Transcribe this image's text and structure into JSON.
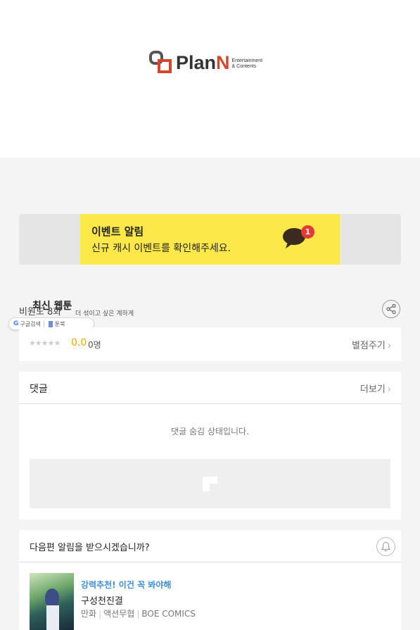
{
  "header": {
    "logo": {
      "name": "PlanN",
      "brand_color": "#d8452e",
      "text_main": "Plan",
      "text_accent": "N",
      "sub_line1": "Entertainment",
      "sub_line2": "& Contents"
    }
  },
  "banner": {
    "title": "이벤트 알림",
    "subtitle": "신규 캐시 이벤트를 확인해주세요.",
    "badge_count": "1",
    "bg_color": "#fde84a"
  },
  "work": {
    "title_overlay": "최신 웹툰",
    "title_line": "비원도 8화",
    "title_line_small": "더 섞이고 싶은 계하게",
    "share_icon": "share-icon"
  },
  "search_chip": {
    "google_label": "구글검색",
    "book_label": "툰북"
  },
  "rating": {
    "stars": "★★★★★",
    "score": "0.0",
    "count": "0명",
    "rate_link": "별점주기"
  },
  "comments": {
    "title": "댓글",
    "more": "더보기",
    "hidden_message": "댓글 숨김 상태입니다."
  },
  "notify": {
    "question": "다음편 알림을 받으시겠습니까?"
  },
  "recommend": {
    "tag": "강력추천! 이건 꼭 봐야해",
    "title": "구성천진결",
    "genre": "만화",
    "category": "액션무협",
    "publisher": "BOE COMICS"
  }
}
